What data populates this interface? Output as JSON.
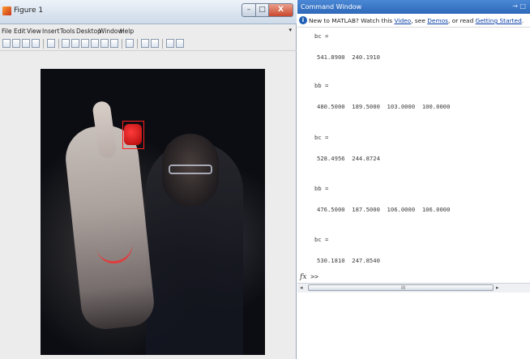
{
  "figure_window": {
    "title": "Figure 1",
    "caption_buttons": {
      "minimize": "–",
      "maximize": "□",
      "close": "X"
    },
    "menu": [
      "File",
      "Edit",
      "View",
      "Insert",
      "Tools",
      "Desktop",
      "Window",
      "Help"
    ],
    "menu_overflow": "▾"
  },
  "command_window": {
    "title": "Command Window",
    "dock_icons": "→ □",
    "info": {
      "prefix": "New to MATLAB? Watch this ",
      "video_link": "Video",
      "mid1": ", see ",
      "demos_link": "Demos",
      "mid2": ", or read ",
      "getting_started_link": "Getting Started",
      "suffix": "."
    },
    "output": [
      {
        "name": "bc =",
        "value": "541.8900  240.1910"
      },
      {
        "name": "bb =",
        "value": "480.5000  189.5000  103.0000  100.0000"
      },
      {
        "name": "bc =",
        "value": "528.4956  244.8724"
      },
      {
        "name": "bb =",
        "value": "476.5000  187.5000  106.0000  106.0000"
      },
      {
        "name": "bc =",
        "value": "530.1810  247.8540"
      }
    ],
    "prompt": {
      "fx": "fx",
      "symbol": ">>"
    },
    "scroll_grip": "III"
  }
}
